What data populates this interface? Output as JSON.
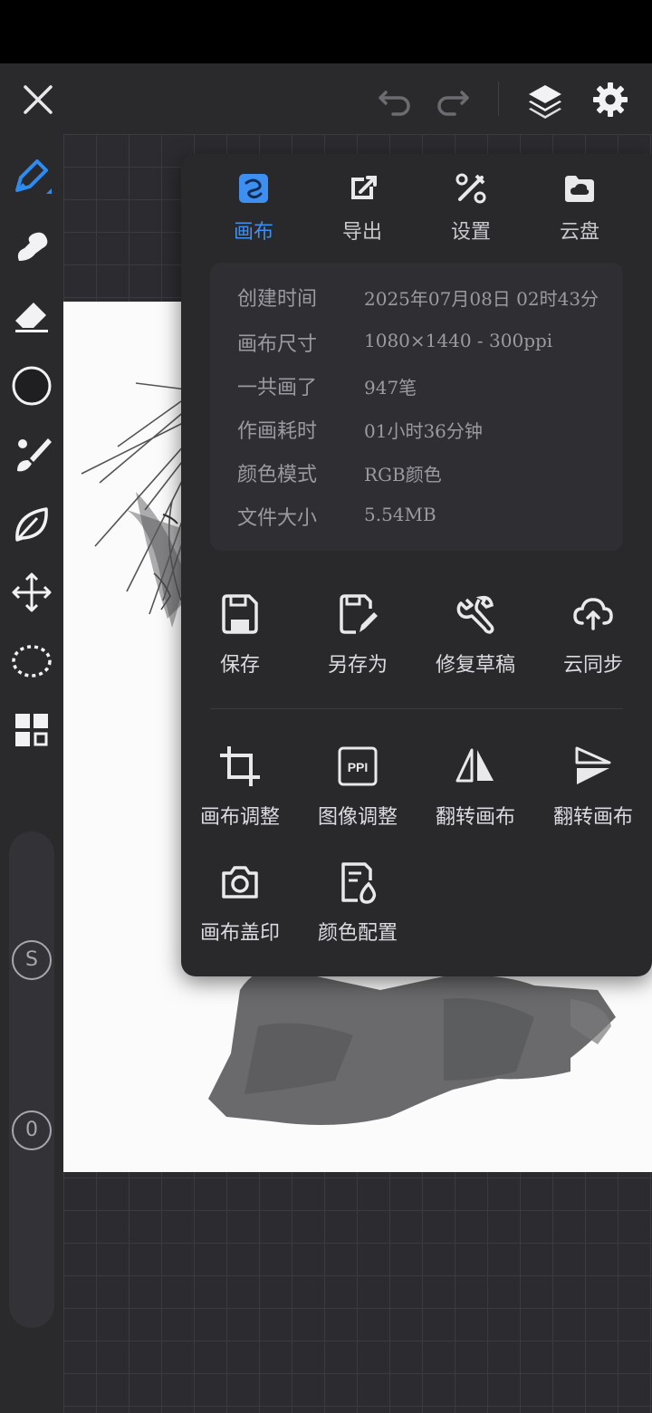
{
  "toolbar": {
    "close": "close-icon",
    "undo": "undo-icon",
    "redo": "redo-icon",
    "layers": "layers-icon",
    "settings": "gear-icon"
  },
  "left_tools": [
    "pen-icon",
    "smudge-icon",
    "eraser-icon",
    "color-circle-icon",
    "brush-icon",
    "leaf-icon",
    "move-icon",
    "lasso-icon",
    "grid-icon"
  ],
  "sliders": {
    "size_label": "S",
    "opacity_label": "0"
  },
  "panel": {
    "tabs": [
      {
        "label": "画布",
        "icon": "canvas-icon",
        "active": true
      },
      {
        "label": "导出",
        "icon": "export-icon",
        "active": false
      },
      {
        "label": "设置",
        "icon": "tools-icon",
        "active": false
      },
      {
        "label": "云盘",
        "icon": "cloud-drive-icon",
        "active": false
      }
    ],
    "info": [
      {
        "key": "创建时间",
        "value": "2025年07月08日 02时43分"
      },
      {
        "key": "画布尺寸",
        "value": "1080×1440 - 300ppi"
      },
      {
        "key": "一共画了",
        "value": "947笔"
      },
      {
        "key": "作画耗时",
        "value": "01小时36分钟"
      },
      {
        "key": "颜色模式",
        "value": "RGB颜色"
      },
      {
        "key": "文件大小",
        "value": "5.54MB"
      }
    ],
    "actions_top": [
      {
        "label": "保存",
        "icon": "save-icon"
      },
      {
        "label": "另存为",
        "icon": "save-as-icon"
      },
      {
        "label": "修复草稿",
        "icon": "wrench-icon"
      },
      {
        "label": "云同步",
        "icon": "cloud-sync-icon"
      }
    ],
    "actions_bottom": [
      {
        "label": "画布调整",
        "icon": "crop-icon"
      },
      {
        "label": "图像调整",
        "icon": "ppi-icon",
        "badge": "PPI"
      },
      {
        "label": "翻转画布",
        "icon": "flip-horizontal-icon"
      },
      {
        "label": "翻转画布",
        "icon": "flip-vertical-icon"
      },
      {
        "label": "画布盖印",
        "icon": "camera-icon"
      },
      {
        "label": "颜色配置",
        "icon": "color-profile-icon"
      }
    ]
  },
  "colors": {
    "accent": "#3d8ff0",
    "panel_bg": "#29292c",
    "info_bg": "#2f2f33"
  }
}
